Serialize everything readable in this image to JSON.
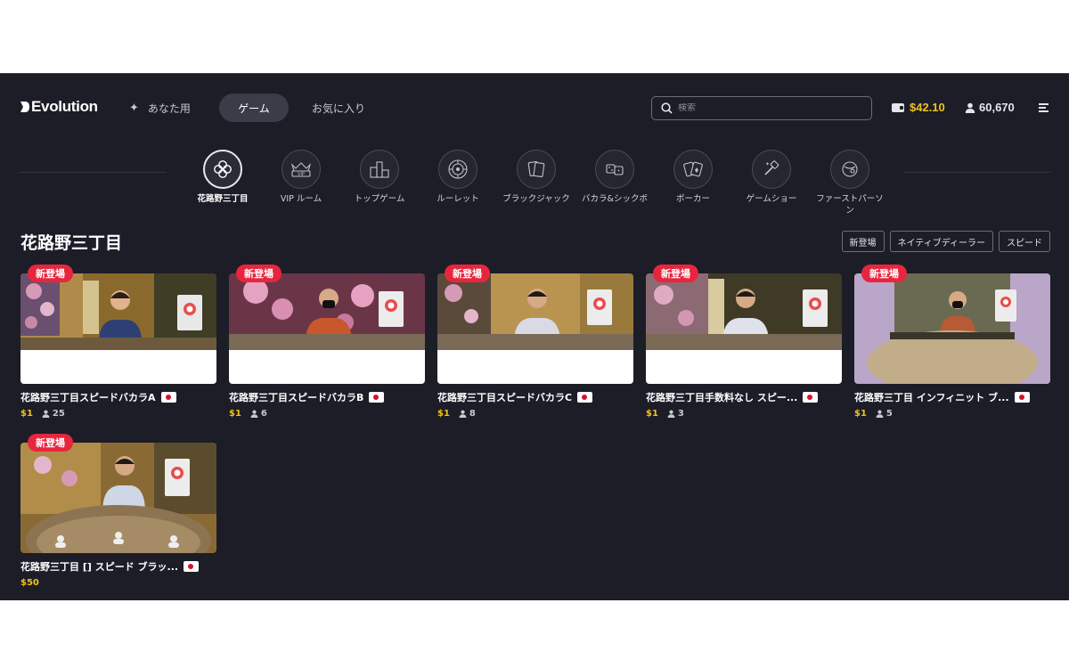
{
  "brand": {
    "name": "Evolution"
  },
  "nav": {
    "for_you": "あなた用",
    "games": "ゲーム",
    "favorites": "お気に入り"
  },
  "search": {
    "placeholder": "検索"
  },
  "account": {
    "balance": "$42.10",
    "players": "60,670"
  },
  "categories": [
    {
      "label": "花路野三丁目",
      "icon": "hanamichi-icon",
      "active": true
    },
    {
      "label": "VIP ルーム",
      "icon": "vip-icon"
    },
    {
      "label": "トップゲーム",
      "icon": "top-games-icon"
    },
    {
      "label": "ルーレット",
      "icon": "roulette-icon"
    },
    {
      "label": "ブラックジャック",
      "icon": "blackjack-icon"
    },
    {
      "label": "バカラ&シックボ",
      "icon": "baccarat-sicbo-icon"
    },
    {
      "label": "ポーカー",
      "icon": "poker-icon"
    },
    {
      "label": "ゲームショー",
      "icon": "game-show-icon"
    },
    {
      "label": "ファーストパーソン",
      "icon": "first-person-icon"
    }
  ],
  "section": {
    "title": "花路野三丁目"
  },
  "filters": [
    "新登場",
    "ネイティブディーラー",
    "スピード"
  ],
  "badge_label": "新登場",
  "tiles": [
    {
      "name": "花路野三丁目スピードバカラA",
      "price": "$1",
      "players": "25"
    },
    {
      "name": "花路野三丁目スピードバカラB",
      "price": "$1",
      "players": "6"
    },
    {
      "name": "花路野三丁目スピードバカラC",
      "price": "$1",
      "players": "8"
    },
    {
      "name": "花路野三丁目手数料なし スピー...",
      "price": "$1",
      "players": "3"
    },
    {
      "name": "花路野三丁目 インフィニット ブ...",
      "price": "$1",
      "players": "5"
    },
    {
      "name": "花路野三丁目 [] スピード ブラッ...",
      "price": "$50",
      "players": ""
    }
  ],
  "colors": {
    "background": "#1c1d27",
    "accent_gold": "#f2c21b",
    "badge_red": "#e7263e",
    "pill": "#3a3c48"
  }
}
